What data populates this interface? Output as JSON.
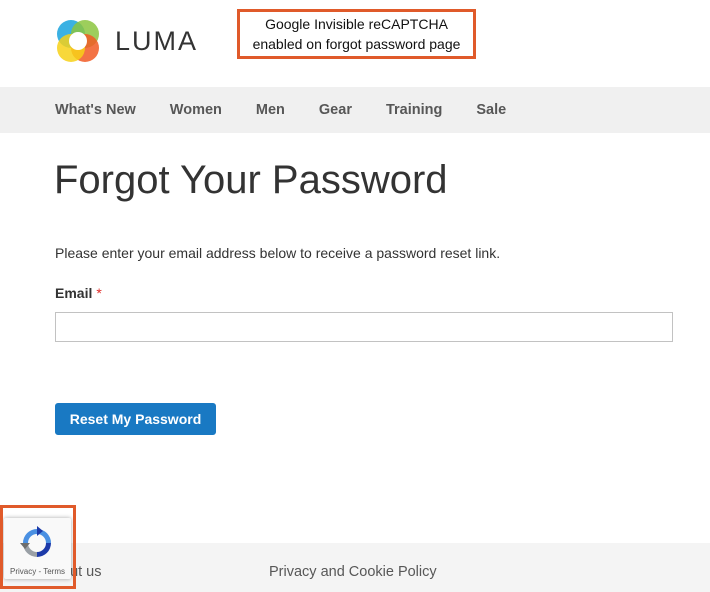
{
  "brand": {
    "name": "LUMA"
  },
  "callout": {
    "line1": "Google Invisible reCAPTCHA",
    "line2": "enabled on forgot password page"
  },
  "nav": {
    "items": [
      "What's New",
      "Women",
      "Men",
      "Gear",
      "Training",
      "Sale"
    ]
  },
  "page": {
    "title": "Forgot Your Password",
    "intro": "Please enter your email address below to receive a password reset link.",
    "email_label": "Email",
    "required_marker": "*",
    "email_value": "",
    "reset_label": "Reset My Password"
  },
  "footer": {
    "about": "out us",
    "privacy": "Privacy and Cookie Policy"
  },
  "recaptcha": {
    "links": "Privacy - Terms"
  },
  "colors": {
    "accent": "#1979c3",
    "callout_border": "#e05a2a",
    "required": "#e02b27"
  },
  "icons": {
    "logo": "luma-logo-icon",
    "captcha": "recaptcha-icon"
  }
}
